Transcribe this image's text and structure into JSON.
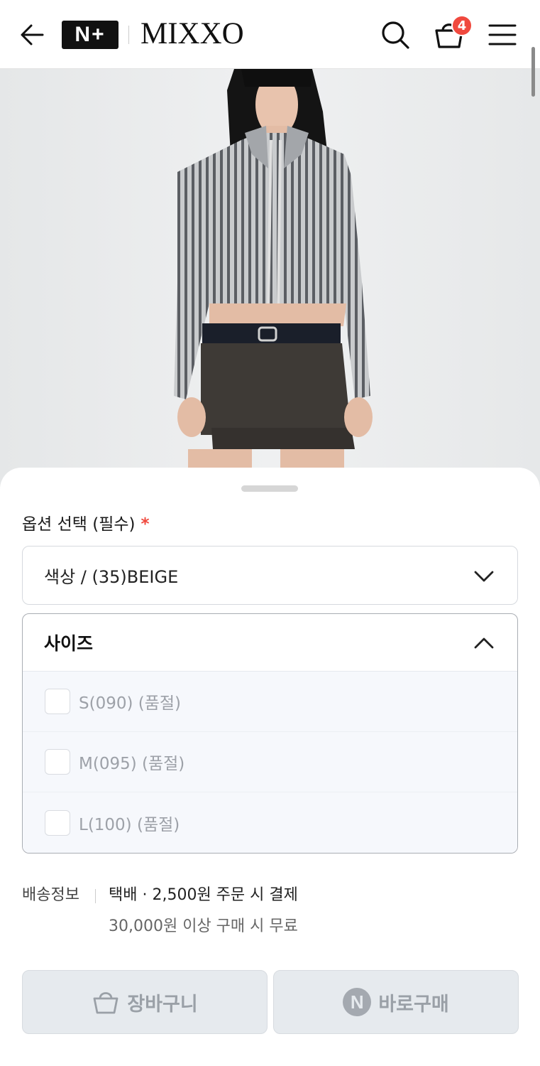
{
  "header": {
    "nplus_logo": "N+",
    "brand": "MIXXO",
    "cart_count": "4"
  },
  "product": {
    "image_alt": "model wearing ribbed zip cardigan and mini skirt"
  },
  "options": {
    "title": "옵션 선택 (필수)",
    "required_mark": "*",
    "color_select": "색상 / (35)BEIGE",
    "size_title": "사이즈",
    "sizes": [
      {
        "label": "S(090) (품절)"
      },
      {
        "label": "M(095) (품절)"
      },
      {
        "label": "L(100) (품절)"
      }
    ]
  },
  "shipping": {
    "label": "배송정보",
    "line1": "택배 · 2,500원 주문 시 결제",
    "line2": "30,000원 이상 구매 시 무료"
  },
  "actions": {
    "cart_label": "장바구니",
    "buy_icon_letter": "N",
    "buy_label": "바로구매"
  },
  "colors": {
    "badge": "#f0493e",
    "button_bg": "#e6eaee",
    "button_text": "#9aa0a7"
  }
}
